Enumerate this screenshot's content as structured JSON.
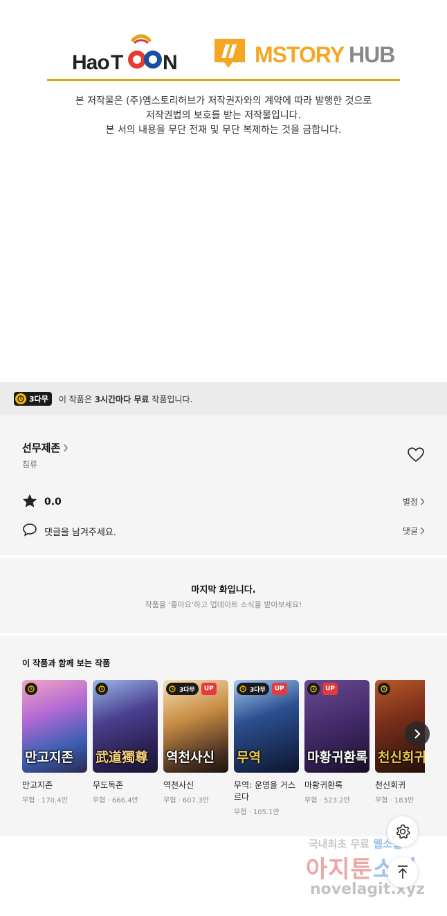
{
  "banner": {
    "logo_left": "HaoTOON",
    "logo_right": "MSTORYHUB",
    "notice_lines": [
      "본 저작물은 (주)엠스토리허브가 저작권자와의 계약에 따라 발행한 것으로",
      "저작권법의 보호를 받는 저작물입니다.",
      "본 서의 내용을 무단 전재 및 무단 복제하는 것을 금합니다."
    ]
  },
  "free_bar": {
    "badge": "3다무",
    "text_prefix": "이 작품은 ",
    "text_bold": "3시간마다 무료",
    "text_suffix": " 작품입니다."
  },
  "work": {
    "title": "선무제존",
    "author": "침류",
    "rating": "0.0",
    "rating_link": "별점",
    "comment_placeholder": "댓글을 남겨주세요.",
    "comment_link": "댓글"
  },
  "last_episode": {
    "heading": "마지막 화입니다.",
    "sub": "작품을 '좋아요'하고 업데이트 소식을 받아보세요!"
  },
  "recommend": {
    "title": "이 작품과 함께 보는 작품",
    "items": [
      {
        "name": "만고지존",
        "meta": "무협 · 170.4만",
        "art": "만고지존",
        "badge3": false,
        "up": false
      },
      {
        "name": "무도독존",
        "meta": "무협 · 666.4만",
        "art": "武道獨尊",
        "badge3": false,
        "up": false
      },
      {
        "name": "역천사신",
        "meta": "무협 · 607.3만",
        "art": "역천사신",
        "badge3": true,
        "up": true
      },
      {
        "name": "무역: 운명을 거스르다",
        "meta": "무협 · 105.1만",
        "art": "무역",
        "badge3": true,
        "up": true
      },
      {
        "name": "마황귀환록",
        "meta": "무협 · 523.2만",
        "art": "마황귀환록",
        "badge3": false,
        "up": true
      },
      {
        "name": "천신회귀",
        "meta": "무협 · 183만",
        "art": "천신회귀",
        "badge3": false,
        "up": false
      }
    ],
    "badge3_label": "3다무",
    "up_label": "UP"
  },
  "watermark": {
    "line1_a": "국내최초 무료 ",
    "line1_b": "웹소설",
    "line2_a": "아지툰",
    "line2_b": "소설",
    "line3": "novelagit.xyz"
  },
  "colors": {
    "accent_gold": "#e1a313",
    "badge_yellow": "#f5b700",
    "up_red": "#e33b3b",
    "panel_bg": "#f5f5f5"
  },
  "icons": [
    "clock-icon",
    "chevron-right-icon",
    "heart-icon",
    "star-icon",
    "comment-icon",
    "settings-icon",
    "arrow-up-icon"
  ]
}
